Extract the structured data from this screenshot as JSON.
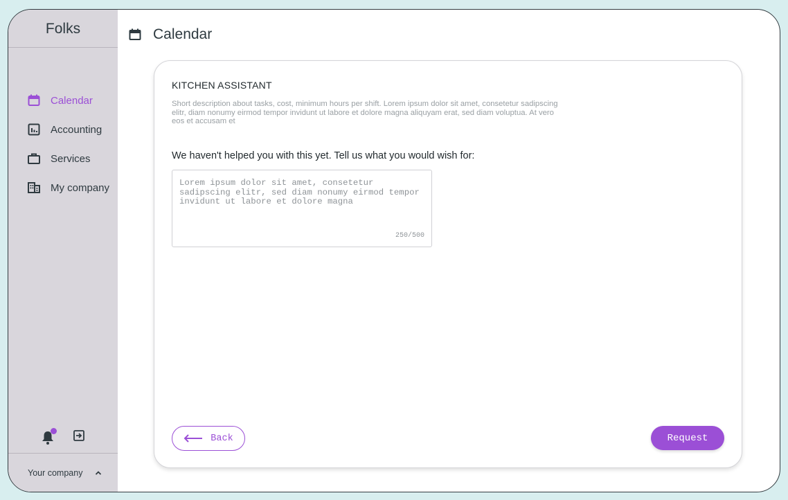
{
  "app": {
    "brand": "Folks"
  },
  "sidebar": {
    "items": [
      {
        "label": "Calendar",
        "icon": "calendar-icon",
        "active": true
      },
      {
        "label": "Accounting",
        "icon": "chart-icon",
        "active": false
      },
      {
        "label": "Services",
        "icon": "briefcase-icon",
        "active": false
      },
      {
        "label": "My company",
        "icon": "building-icon",
        "active": false
      }
    ],
    "company_label": "Your company"
  },
  "header": {
    "title": "Calendar",
    "icon": "calendar-icon"
  },
  "card": {
    "title": "KITCHEN ASSISTANT",
    "description": "Short description about tasks, cost, minimum hours per shift. Lorem ipsum dolor sit amet, consetetur sadipscing elitr, diam nonumy eirmod tempor invidunt ut labore et dolore magna aliquyam erat, sed diam voluptua. At vero eos et accusam et",
    "prompt": "We haven't helped you with this yet. Tell us what you would wish for:",
    "textarea_value": "Lorem ipsum dolor sit amet, consetetur sadipscing elitr, sed diam nonumy eirmod tempor invidunt ut labore et dolore magna",
    "counter": "250/500",
    "back_label": "Back",
    "request_label": "Request"
  },
  "colors": {
    "accent": "#9b4fd6",
    "sidebar_bg": "#d9d6dc",
    "page_bg": "#d8eeef",
    "text": "#2e3a40"
  }
}
